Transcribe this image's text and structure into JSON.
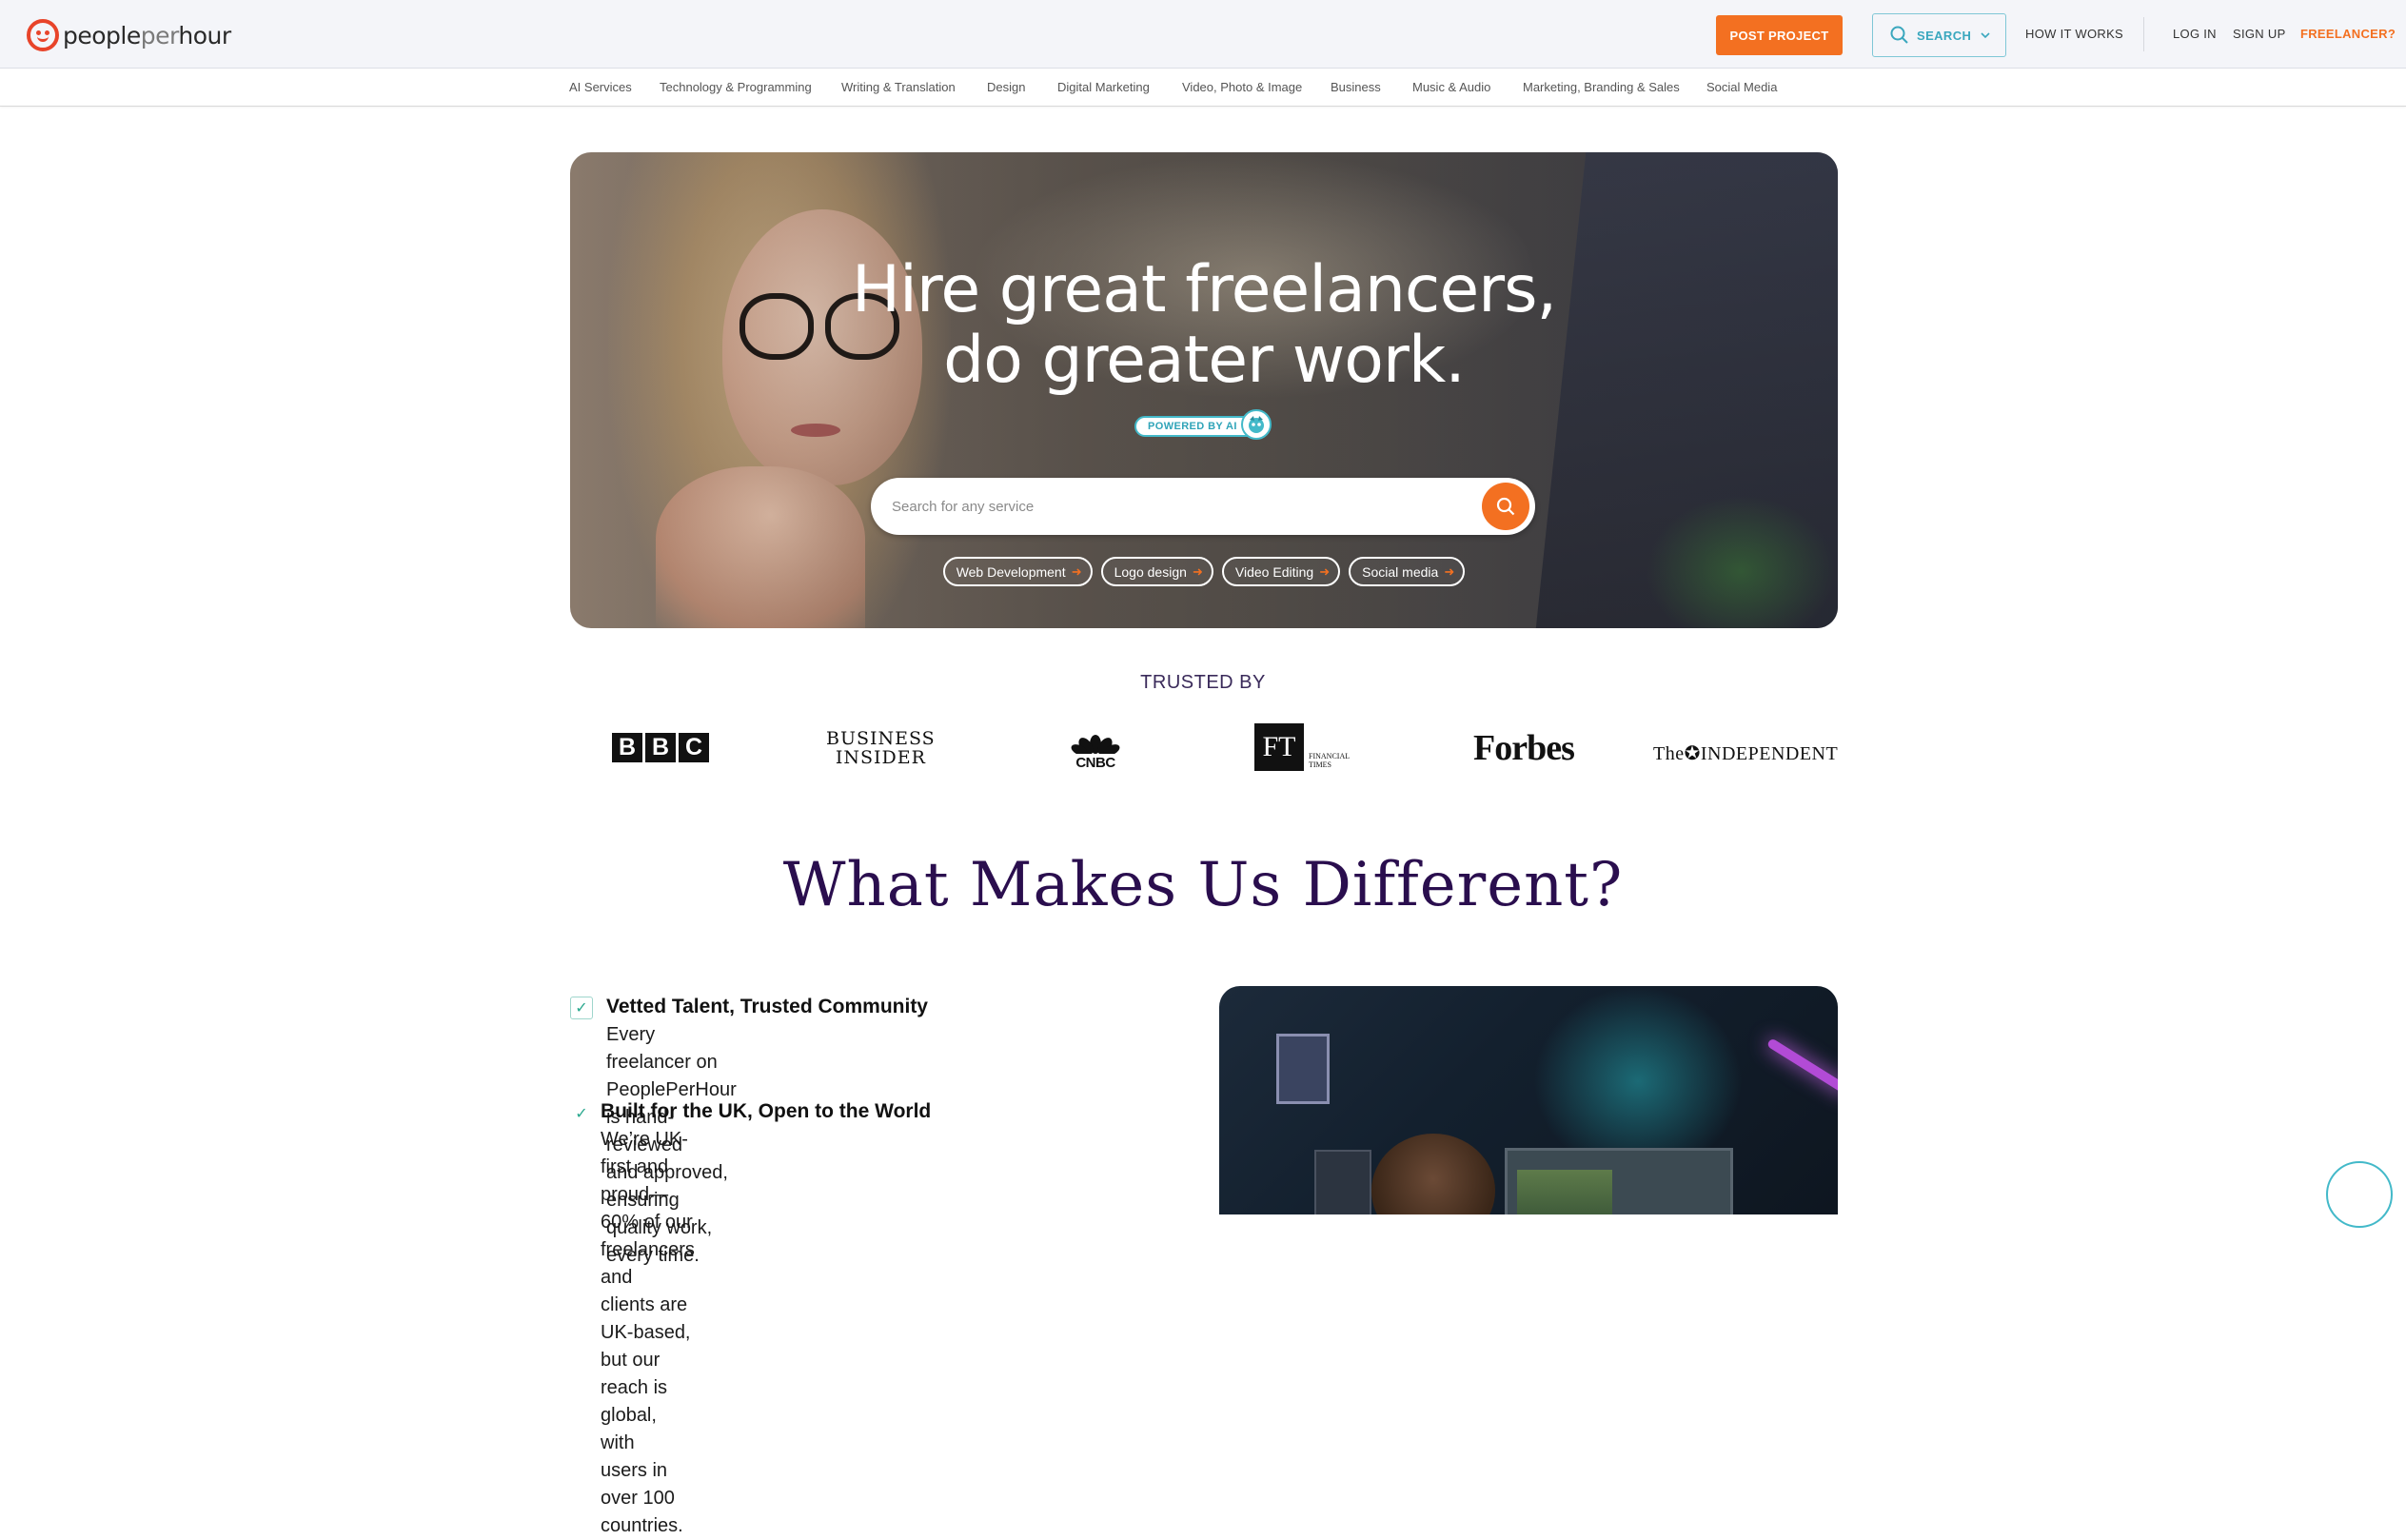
{
  "header": {
    "logo_people": "people",
    "logo_per": "per",
    "logo_hour": "hour",
    "post_project": "POST PROJECT",
    "search": "SEARCH",
    "how_it_works": "HOW IT WORKS",
    "log_in": "LOG IN",
    "sign_up": "SIGN UP",
    "freelancer": "FREELANCER?",
    "accent_color": "#f37021",
    "search_color": "#3aa7be"
  },
  "categories": [
    "AI Services",
    "Technology & Programming",
    "Writing & Translation",
    "Design",
    "Digital Marketing",
    "Video, Photo & Image",
    "Business",
    "Music & Audio",
    "Marketing, Branding & Sales",
    "Social Media"
  ],
  "hero": {
    "title_line1": "Hire great freelancers,",
    "title_line2": "do greater work.",
    "ai_badge": "POWERED BY AI",
    "search_placeholder": "Search for any service",
    "chips": [
      "Web Development",
      "Logo design",
      "Video Editing",
      "Social media"
    ]
  },
  "trusted": {
    "label": "TRUSTED BY",
    "brands": {
      "bbc": [
        "B",
        "B",
        "C"
      ],
      "business_insider_1": "BUSINESS",
      "business_insider_2": "INSIDER",
      "cnbc": "CNBC",
      "ft_mark": "FT",
      "ft_small_1": "FINANCIAL",
      "ft_small_2": "TIMES",
      "forbes": "Forbes",
      "independent": "The✪INDEPENDENT"
    }
  },
  "different": {
    "title": "What Makes Us Different?",
    "features": [
      {
        "title": "Vetted Talent, Trusted Community",
        "lines": [
          "Every freelancer on PeoplePerHour is hand-reviewed",
          "and approved, ensuring quality work, every time."
        ]
      },
      {
        "title": "Built for the UK, Open to the World",
        "lines": [
          "We’re UK-first and proud—60% of our freelancers and",
          "clients are UK-based, but our reach is global, with",
          "users in over 100 countries."
        ]
      }
    ]
  }
}
